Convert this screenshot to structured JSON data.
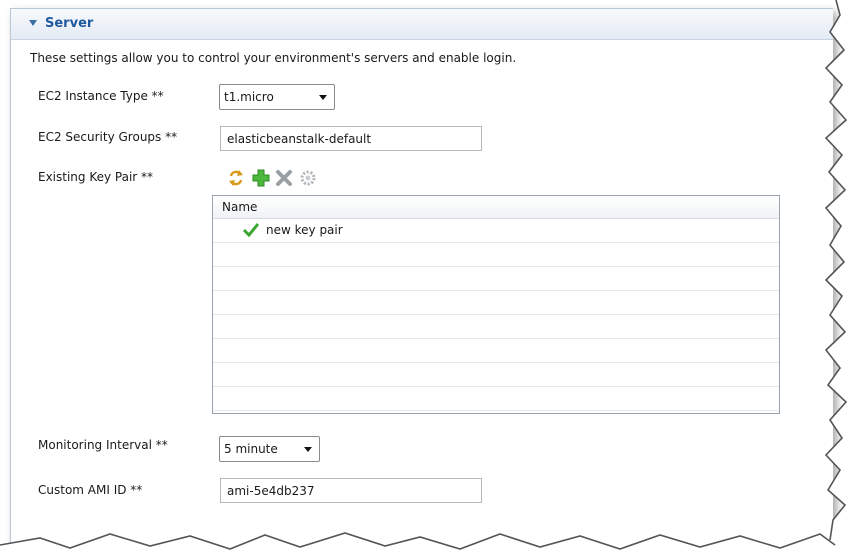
{
  "section": {
    "title": "Server",
    "description": "These settings allow you to control your environment's servers and enable login."
  },
  "fields": {
    "instance_type": {
      "label": "EC2 Instance Type **",
      "value": "t1.micro"
    },
    "security_groups": {
      "label": "EC2 Security Groups **",
      "value": "elasticbeanstalk-default"
    },
    "key_pair": {
      "label": "Existing Key Pair **"
    },
    "monitoring_interval": {
      "label": "Monitoring Interval **",
      "value": "5 minute"
    },
    "custom_ami": {
      "label": "Custom AMI ID **",
      "value": "ami-5e4db237"
    }
  },
  "key_pair_toolbar": {
    "icons": [
      "refresh-icon",
      "add-icon",
      "delete-icon",
      "settings-icon"
    ]
  },
  "key_pair_table": {
    "column_header": "Name",
    "rows": [
      {
        "name": "new key pair",
        "selected": true
      }
    ]
  },
  "colors": {
    "section_title": "#1f5a9e",
    "header_bg": "#e4ebf5",
    "check_green": "#3aa832"
  }
}
